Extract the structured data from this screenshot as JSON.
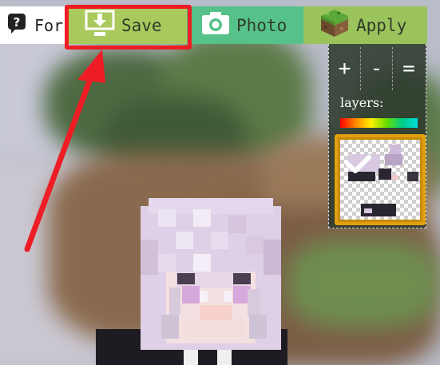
{
  "toolbar": {
    "forum_label": "Foru",
    "save_label": "Save",
    "photo_label": "Photo",
    "apply_label": "Apply"
  },
  "layers_panel": {
    "add_label": "+",
    "remove_label": "-",
    "merge_label": "=",
    "layers_label": "layers:"
  },
  "icons": {
    "forum": "forum-bubble-icon",
    "save": "download-icon",
    "photo": "camera-icon",
    "apply": "grass-block-icon",
    "layer_check": "checkmark-icon"
  },
  "colors": {
    "highlight": "#ee1c24",
    "arrow": "#ee1c24",
    "save_bg": "#a9c95d",
    "photo_bg": "#56c28a",
    "apply_bg": "#9bc35b",
    "panel_bg": "#2d3a2d",
    "thumb_border": "#e2a010"
  }
}
